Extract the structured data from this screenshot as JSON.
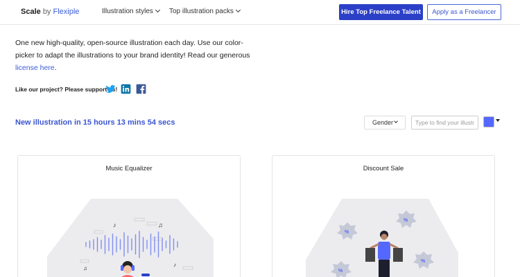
{
  "header": {
    "brand_bold": "Scale",
    "brand_by": "by",
    "brand_name": "Flexiple",
    "nav": [
      {
        "label": "Illustration styles"
      },
      {
        "label": "Top illustration packs"
      }
    ],
    "hire_label": "Hire Top Freelance Talent",
    "apply_label": "Apply as a Freelancer"
  },
  "intro": {
    "text": "One new high-quality, open-source illustration each day. Use our color-picker to adapt the illustrations to your brand identity! Read our generous ",
    "link1": "license",
    "link2": "here",
    "tail": "."
  },
  "support": {
    "label": "Like our project? Please support us!",
    "icons": [
      "twitter-icon",
      "linkedin-icon",
      "facebook-icon"
    ]
  },
  "countdown": {
    "text": "New illustration in 15 hours 13 mins 54 secs"
  },
  "filters": {
    "gender_label": "Gender",
    "search_placeholder": "Type to find your illustration",
    "color": "#5468ff"
  },
  "cards": [
    {
      "title": "Music Equalizer"
    },
    {
      "title": "Discount Sale"
    }
  ],
  "colors": {
    "accent": "#3b55d0",
    "button": "#2b3fc7"
  }
}
